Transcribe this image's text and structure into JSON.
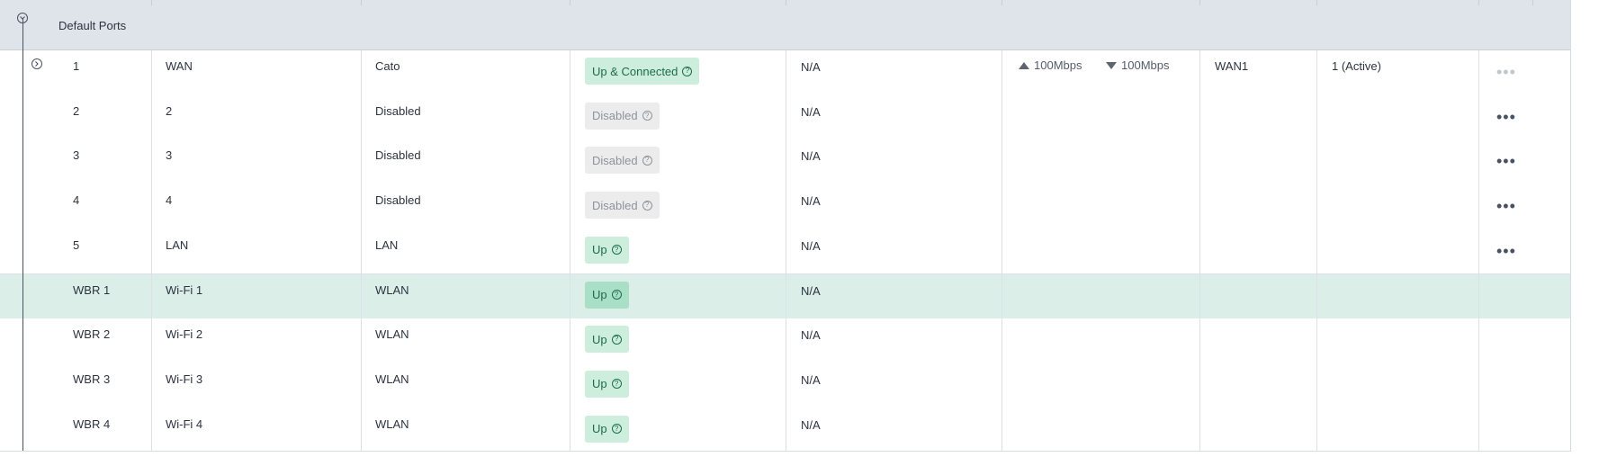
{
  "group": {
    "title": "Default Ports"
  },
  "rows": [
    {
      "col1": "1",
      "col2": "WAN",
      "col3": "Cato",
      "status": "Up & Connected",
      "status_type": "green",
      "col5": "N/A",
      "upload": "100Mbps",
      "download": "100Mbps",
      "col7": "WAN1",
      "col8": "1 (Active)",
      "actions": "•••",
      "actions_dim": true,
      "expander": true
    },
    {
      "col1": "2",
      "col2": "2",
      "col3": "Disabled",
      "status": "Disabled",
      "status_type": "grey",
      "col5": "N/A",
      "actions": "•••"
    },
    {
      "col1": "3",
      "col2": "3",
      "col3": "Disabled",
      "status": "Disabled",
      "status_type": "grey",
      "col5": "N/A",
      "actions": "•••"
    },
    {
      "col1": "4",
      "col2": "4",
      "col3": "Disabled",
      "status": "Disabled",
      "status_type": "grey",
      "col5": "N/A",
      "actions": "•••"
    },
    {
      "col1": "5",
      "col2": "LAN",
      "col3": "LAN",
      "status": "Up",
      "status_type": "green",
      "col5": "N/A",
      "actions": "•••"
    },
    {
      "col1": "WBR 1",
      "col2": "Wi-Fi 1",
      "col3": "WLAN",
      "status": "Up",
      "status_type": "green",
      "col5": "N/A",
      "highlight": true
    },
    {
      "col1": "WBR 2",
      "col2": "Wi-Fi 2",
      "col3": "WLAN",
      "status": "Up",
      "status_type": "green",
      "col5": "N/A"
    },
    {
      "col1": "WBR 3",
      "col2": "Wi-Fi 3",
      "col3": "WLAN",
      "status": "Up",
      "status_type": "green",
      "col5": "N/A"
    },
    {
      "col1": "WBR 4",
      "col2": "Wi-Fi 4",
      "col3": "WLAN",
      "status": "Up",
      "status_type": "green",
      "col5": "N/A"
    }
  ],
  "icons": {
    "collapse": "chevron-down-circle-icon",
    "expand": "chevron-right-circle-icon",
    "help": "question-circle-icon",
    "upload": "triangle-up-icon",
    "download": "triangle-down-icon",
    "more": "more-horizontal-icon"
  },
  "colors": {
    "group_bg": "#dfe3ea",
    "highlight_row": "#dbeee7",
    "badge_green_bg": "#cdeedd",
    "badge_green_text": "#1d6b4b",
    "badge_grey_bg": "#ececec",
    "badge_grey_text": "#8e939b"
  }
}
